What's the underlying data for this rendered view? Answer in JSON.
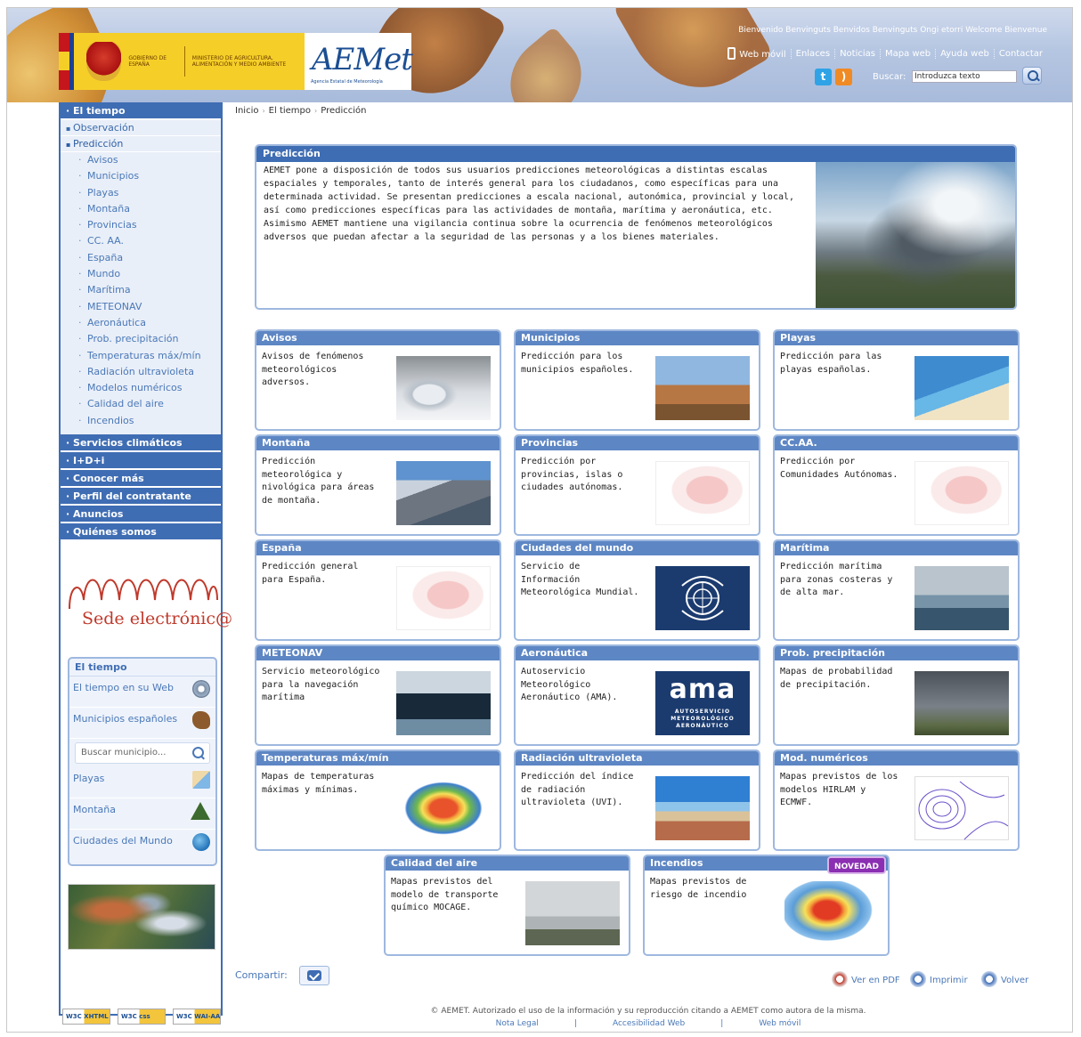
{
  "header": {
    "welcome": "Bienvenido Benvinguts Benvidos Benvinguts Ongi etorri Welcome Bienvenue",
    "gobierno": "GOBIERNO DE ESPAÑA",
    "ministerio": "MINISTERIO DE AGRICULTURA, ALIMENTACIÓN Y MEDIO AMBIENTE",
    "logo": "AEMet",
    "logo_sub": "Agencia Estatal de Meteorología",
    "links": [
      "Web móvil",
      "Enlaces",
      "Noticias",
      "Mapa web",
      "Ayuda web",
      "Contactar"
    ],
    "search_label": "Buscar:",
    "search_placeholder": "Introduzca texto"
  },
  "breadcrumb": [
    "Inicio",
    "El tiempo",
    "Predicción"
  ],
  "sidebar": {
    "el_tiempo": "El tiempo",
    "observacion": "Observación",
    "prediccion": "Predicción",
    "prediccion_items": [
      "Avisos",
      "Municipios",
      "Playas",
      "Montaña",
      "Provincias",
      "CC. AA.",
      "España",
      "Mundo",
      "Marítima",
      "METEONAV",
      "Aeronáutica",
      "Prob. precipitación",
      "Temperaturas máx/mín",
      "Radiación ultravioleta",
      "Modelos numéricos",
      "Calidad del aire",
      "Incendios"
    ],
    "sections": [
      "Servicios climáticos",
      "I+D+i",
      "Conocer más",
      "Perfil del contratante",
      "Anuncios",
      "Quiénes somos"
    ],
    "sede": "Sede electrónic@",
    "tiempo_box": {
      "title": "El tiempo",
      "en_su_web": "El tiempo en su Web",
      "municipios": "Municipios españoles",
      "buscar_placeholder": "Buscar municipio...",
      "playas": "Playas",
      "montana": "Montaña",
      "ciudades": "Ciudades del Mundo"
    }
  },
  "intro": {
    "title": "Predicción",
    "text": "AEMET pone a disposición de todos sus usuarios predicciones meteorológicas a distintas escalas espaciales y temporales, tanto de interés general para los ciudadanos, como específicas para una determinada actividad. Se presentan predicciones a escala nacional, autonómica, provincial y local, así como predicciones específicas para las actividades de montaña, marítima y aeronáutica, etc. Asimismo AEMET mantiene una vigilancia continua sobre la ocurrencia de fenómenos meteorológicos adversos que puedan afectar a la seguridad de las personas y a los bienes materiales."
  },
  "cards": [
    {
      "title": "Avisos",
      "desc": "Avisos de fenómenos meteorológicos adversos."
    },
    {
      "title": "Municipios",
      "desc": "Predicción para los municipios españoles."
    },
    {
      "title": "Playas",
      "desc": "Predicción para las playas españolas."
    },
    {
      "title": "Montaña",
      "desc": "Predicción meteorológica y nivológica para áreas de montaña."
    },
    {
      "title": "Provincias",
      "desc": "Predicción por provincias, islas o ciudades autónomas."
    },
    {
      "title": "CC.AA.",
      "desc": "Predicción por Comunidades Autónomas."
    },
    {
      "title": "España",
      "desc": "Predicción general para España."
    },
    {
      "title": "Ciudades del mundo",
      "desc": "Servicio de Información Meteorológica Mundial."
    },
    {
      "title": "Marítima",
      "desc": "Predicción marítima para zonas costeras y de alta mar."
    },
    {
      "title": "METEONAV",
      "desc": "Servicio meteorológico para la navegación marítima"
    },
    {
      "title": "Aeronáutica",
      "desc": "Autoservicio Meteorológico Aeronáutico (AMA)."
    },
    {
      "title": "Prob. precipitación",
      "desc": "Mapas de probabilidad de precipitación."
    },
    {
      "title": "Temperaturas máx/mín",
      "desc": "Mapas de temperaturas máximas y mínimas."
    },
    {
      "title": "Radiación ultravioleta",
      "desc": "Predicción del índice de radiación ultravioleta (UVI)."
    },
    {
      "title": "Mod. numéricos",
      "desc": "Mapas previstos de los modelos HIRLAM y ECMWF."
    },
    {
      "title": "Calidad del aire",
      "desc": "Mapas previstos del modelo de transporte químico MOCAGE."
    },
    {
      "title": "Incendios",
      "desc": "Mapas previstos de riesgo de incendio",
      "badge": "NOVEDAD"
    }
  ],
  "ama": {
    "big": "ama",
    "small": "AUTOSERVICIO METEOROLÓGICO AERONÁUTICO"
  },
  "share_label": "Compartir:",
  "tools": {
    "pdf": "Ver en PDF",
    "print": "Imprimir",
    "back": "Volver"
  },
  "w3c": [
    "W3C XHTML 1.0",
    "W3C css",
    "W3C WAI-AA WCAG 1.0"
  ],
  "footer": {
    "copyright": "© AEMET. Autorizado el uso de la información y su reproducción citando a AEMET como autora de la misma.",
    "links": [
      "Nota Legal",
      "Accesibilidad Web",
      "Web móvil"
    ]
  }
}
